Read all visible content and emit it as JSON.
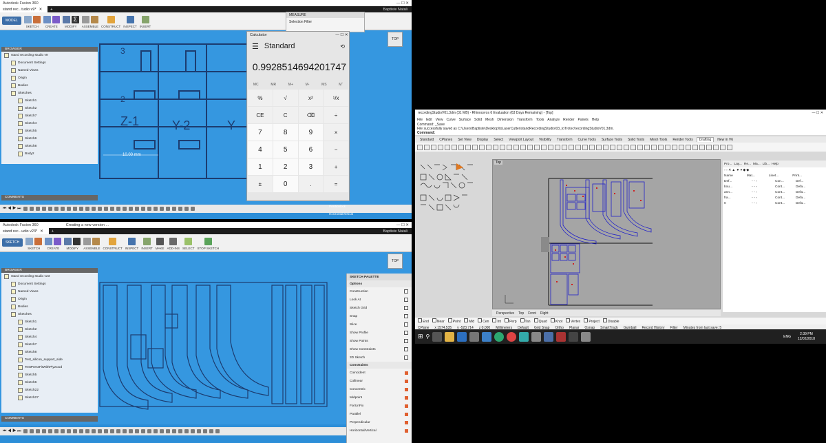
{
  "colors": {
    "fusion_bg": "#3597e0",
    "rhino_curve": "#2020c8",
    "rhino_mark": "#d02020",
    "taskbar": "#202020"
  },
  "fusion_top": {
    "app_title": "Autodesk Fusion 360",
    "tab_label": "stand rec...tudio v9*",
    "user": "Baptiste Natali",
    "model_label": "MODEL",
    "toolbar_groups": [
      "SKETCH",
      "CREATE",
      "MODIFY",
      "ASSEMBLE",
      "CONSTRUCT",
      "INSPECT",
      "INSERT"
    ],
    "browser_title": "BROWSER",
    "tree": [
      "stand recording studio v9",
      "Document Settings",
      "Named Views",
      "Origin",
      "Bodies",
      "Sketches",
      "Sketch1",
      "Sketch2",
      "Sketch7",
      "Sketch4",
      "Sketch5",
      "Sketch6",
      "Sketch8",
      "Body2"
    ],
    "comments": "COMMENTS",
    "dimension_label": "10.00 mm",
    "sketch_labels": [
      "3",
      "2",
      "Z-1",
      "Y-2",
      "Y"
    ],
    "view_cube": "TOP",
    "measure_title": "MEASURE",
    "selection_filter": "Selection Filter",
    "behind_panel": [
      "Positionlock",
      "HorizontalVertical"
    ]
  },
  "calculator": {
    "title": "Calculator",
    "mode": "Standard",
    "display": "0.9928514694201747",
    "memory": [
      "MC",
      "MR",
      "M+",
      "M-",
      "MS",
      "Mˇ"
    ],
    "keys": [
      "%",
      "√",
      "x²",
      "¹/x",
      "CE",
      "C",
      "⌫",
      "÷",
      "7",
      "8",
      "9",
      "×",
      "4",
      "5",
      "6",
      "−",
      "1",
      "2",
      "3",
      "+",
      "±",
      "0",
      ".",
      "="
    ]
  },
  "fusion_bottom": {
    "app_title": "Autodesk Fusion 360",
    "status": "Creating a new version ...",
    "tab_label": "stand rec...udio v23*",
    "user": "Baptiste Natali",
    "model_label": "SKETCH",
    "toolbar_groups": [
      "SKETCH",
      "CREATE",
      "MODIFY",
      "ASSEMBLE",
      "CONSTRUCT",
      "INSPECT",
      "INSERT",
      "MAKE",
      "ADD-INS",
      "SELECT",
      "STOP SKETCH"
    ],
    "browser_title": "BROWSER",
    "tree": [
      "stand recording studio v23",
      "Document Settings",
      "Named Views",
      "Origin",
      "Bodies",
      "Sketches",
      "Sketch1",
      "Sketch2",
      "Sketch4",
      "Sketch7",
      "Sketch8",
      "Test_silicon_support_side",
      "TestPressFitWithPlywood",
      "Sketch5",
      "Sketch6",
      "Sketch22",
      "Sketch27"
    ],
    "comments": "COMMENTS",
    "view_cube": "TOP",
    "palette": {
      "title": "SKETCH PALETTE",
      "options_label": "Options",
      "options": [
        "Construction",
        "Look At",
        "Sketch Grid",
        "Snap",
        "Slice",
        "Show Profile",
        "Show Points",
        "Show Constraints",
        "3D Sketch"
      ],
      "constraints_label": "Constraints",
      "constraints": [
        "Coincident",
        "Collinear",
        "Concentric",
        "Midpoint",
        "Fix/UnFix",
        "Parallel",
        "Perpendicular",
        "Horizontal/Vertical"
      ]
    }
  },
  "rhino": {
    "title": "recordingStudioV01.3dm (31 MB) - Rhinoceros 6 Evaluation (63 Days Remaining) - [Top]",
    "menu": [
      "File",
      "Edit",
      "View",
      "Curve",
      "Surface",
      "Solid",
      "Mesh",
      "Dimension",
      "Transform",
      "Tools",
      "Analyze",
      "Render",
      "Panels",
      "Help"
    ],
    "cmd_lines": [
      "Command: _Save",
      "File successfully saved as C:\\Users\\Baptiste\\Desktop\\toLaserCutter\\standRecordingStudio\\03_toTrotec\\recordingStudioV01.3dm.",
      "Command:"
    ],
    "tabs": [
      "Standard",
      "CPlanes",
      "Set View",
      "Display",
      "Select",
      "Viewport Layout",
      "Visibility",
      "Transform",
      "Curve Tools",
      "Surface Tools",
      "Solid Tools",
      "Mesh Tools",
      "Render Tools",
      "Drafting",
      "New in V6"
    ],
    "active_tab": "Drafting",
    "viewport_label": "Top",
    "view_tabs": [
      "Perspective",
      "Top",
      "Front",
      "Right"
    ],
    "panel_tabs": [
      "Pro...",
      "Lay...",
      "Re...",
      "Ma...",
      "Lib...",
      "Help"
    ],
    "layer_headers": [
      "Name",
      "Mat...",
      "Linet...",
      "Print..."
    ],
    "layers": [
      {
        "name": "Def...",
        "lin": "Con...",
        "pri": "Def..."
      },
      {
        "name": "bou...",
        "lin": "Cont...",
        "pri": "Defa..."
      },
      {
        "name": "ann...",
        "lin": "Cont...",
        "pri": "Defa..."
      },
      {
        "name": "fra...",
        "lin": "Cont...",
        "pri": "Defa..."
      },
      {
        "name": "0",
        "lin": "Cont...",
        "pri": "Defa..."
      }
    ],
    "osnaps": [
      "End",
      "Near",
      "Point",
      "Mid",
      "Cen",
      "Int",
      "Perp",
      "Tan",
      "Quad",
      "Knot",
      "Vertex",
      "Project",
      "Disable"
    ],
    "status": [
      "CPlane",
      "x 1574.535",
      "y -523.714",
      "z 0.000",
      "Millimeters",
      "Default",
      "Grid Snap",
      "Ortho",
      "Planar",
      "Osnap",
      "SmartTrack",
      "Gumball",
      "Record History",
      "Filter",
      "Minutes from last save: 5"
    ]
  },
  "taskbar": {
    "time": "2:39 PM",
    "date": "12/02/2018",
    "lang": "ENG"
  }
}
